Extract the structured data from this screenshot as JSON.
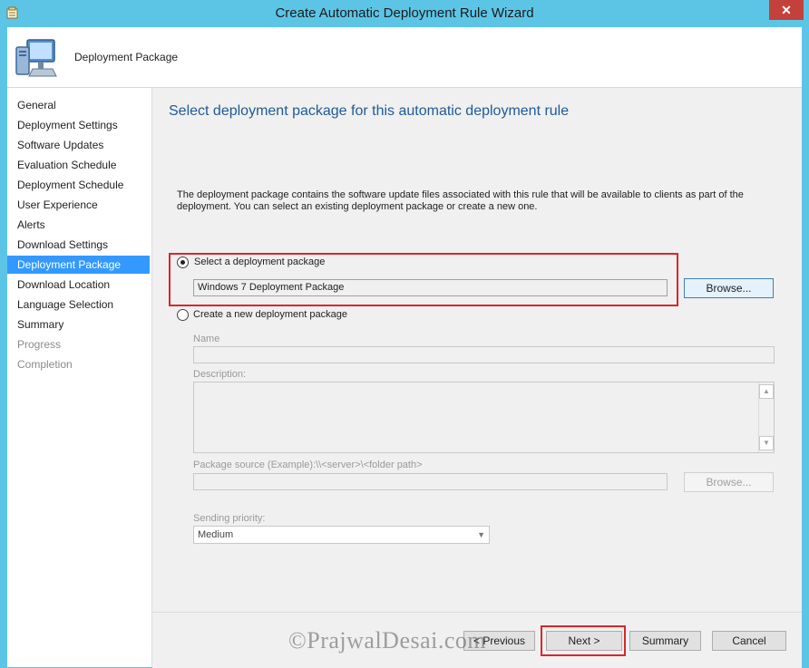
{
  "window": {
    "title": "Create Automatic Deployment Rule Wizard",
    "close_label": "✕"
  },
  "header": {
    "title": "Deployment Package",
    "icon": "computer-icon"
  },
  "nav": {
    "items": [
      {
        "label": "General",
        "state": "normal"
      },
      {
        "label": "Deployment Settings",
        "state": "normal"
      },
      {
        "label": "Software Updates",
        "state": "normal"
      },
      {
        "label": "Evaluation Schedule",
        "state": "normal"
      },
      {
        "label": "Deployment Schedule",
        "state": "normal"
      },
      {
        "label": "User Experience",
        "state": "normal"
      },
      {
        "label": "Alerts",
        "state": "normal"
      },
      {
        "label": "Download Settings",
        "state": "normal"
      },
      {
        "label": "Deployment Package",
        "state": "active"
      },
      {
        "label": "Download Location",
        "state": "normal"
      },
      {
        "label": "Language Selection",
        "state": "normal"
      },
      {
        "label": "Summary",
        "state": "normal"
      },
      {
        "label": "Progress",
        "state": "disabled"
      },
      {
        "label": "Completion",
        "state": "disabled"
      }
    ]
  },
  "main": {
    "heading": "Select deployment package for this automatic deployment rule",
    "description": "The deployment package contains the software update files associated with this rule that will be available to clients as part of the deployment. You can select an existing deployment package or create a new one.",
    "option_existing": {
      "label": "Select a deployment package",
      "selected": true,
      "value": "Windows 7 Deployment Package",
      "browse_label": "Browse..."
    },
    "option_new": {
      "label": "Create a new deployment package",
      "selected": false,
      "name_label": "Name",
      "name_value": "",
      "description_label": "Description:",
      "source_label": "Package source (Example):\\\\<server>\\<folder path>",
      "source_value": "",
      "browse_label": "Browse...",
      "priority_label": "Sending priority:",
      "priority_value": "Medium"
    }
  },
  "footer": {
    "previous_label": "< Previous",
    "next_label": "Next >",
    "summary_label": "Summary",
    "cancel_label": "Cancel"
  },
  "watermark": "©PrajwalDesai.com",
  "colors": {
    "titlebar": "#5cc5e6",
    "nav_active": "#3399ff",
    "heading": "#1e5a96",
    "highlight": "#d9262c",
    "close": "#c4413b"
  }
}
